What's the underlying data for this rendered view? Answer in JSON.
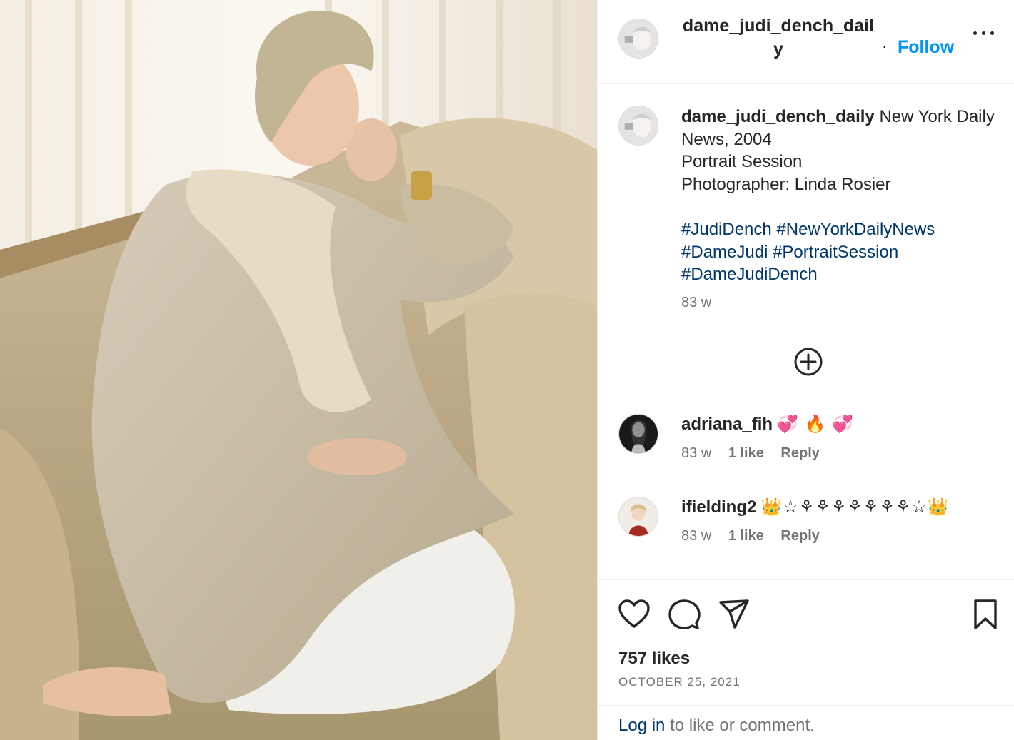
{
  "post": {
    "image_alt": "Portrait photo of a woman with short grey hair sitting on a beige sofa, looking out a window"
  },
  "header": {
    "username": "dame_judi_dench_daily",
    "follow_label": "Follow",
    "dot": "·"
  },
  "caption": {
    "username": "dame_judi_dench_daily",
    "lines": [
      "New York Daily News, 2004",
      "Portrait Session",
      "Photographer: Linda Rosier"
    ],
    "hashtags": [
      "#JudiDench",
      "#NewYorkDailyNews",
      "#DameJudi",
      "#PortraitSession",
      "#DameJudiDench"
    ],
    "time": "83 w"
  },
  "comments": [
    {
      "username": "adriana_fih",
      "text": "💞 🔥 💞",
      "time": "83 w",
      "likes": "1 like",
      "reply": "Reply"
    },
    {
      "username": "ifielding2",
      "text": "👑☆⚘⚘⚘⚘⚘⚘⚘☆👑",
      "time": "83 w",
      "likes": "1 like",
      "reply": "Reply"
    }
  ],
  "footer": {
    "likes": "757 likes",
    "date": "OCTOBER 25, 2021",
    "login_link": "Log in",
    "login_rest": " to like or comment."
  },
  "icons": {
    "header_avatar": "profile-avatar-icon",
    "more": "more-options-icon",
    "load_more": "plus-circle-icon",
    "like": "heart-icon",
    "comment": "comment-bubble-icon",
    "share": "paper-plane-icon",
    "save": "bookmark-icon"
  },
  "colors": {
    "follow": "#0095f6",
    "hashtag": "#00376b",
    "muted": "#737373",
    "text": "#262626"
  }
}
